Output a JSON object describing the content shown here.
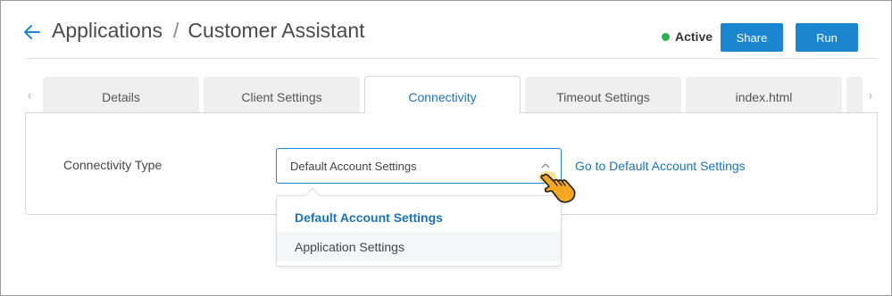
{
  "header": {
    "breadcrumb_parent": "Applications",
    "separator": "/",
    "page_title": "Customer Assistant",
    "status_label": "Active",
    "status_color": "#2bb24c",
    "share_label": "Share",
    "run_label": "Run",
    "accent_color": "#1a86d0"
  },
  "tabs": [
    {
      "label": "Details",
      "active": false
    },
    {
      "label": "Client Settings",
      "active": false
    },
    {
      "label": "Connectivity",
      "active": true
    },
    {
      "label": "Timeout Settings",
      "active": false
    },
    {
      "label": "index.html",
      "active": false
    }
  ],
  "tab_scroll": {
    "left_icon": "‹",
    "right_icon": "›"
  },
  "form": {
    "connectivity_label": "Connectivity Type",
    "selected_value": "Default Account Settings",
    "link_text": "Go to Default Account Settings"
  },
  "dropdown": {
    "options": [
      {
        "label": "Default Account Settings",
        "selected": true
      },
      {
        "label": "Application Settings",
        "selected": false
      }
    ]
  },
  "icons": {
    "back": "back-arrow-icon",
    "chevron": "chevron-up-icon",
    "cursor": "hand-pointer-icon"
  }
}
